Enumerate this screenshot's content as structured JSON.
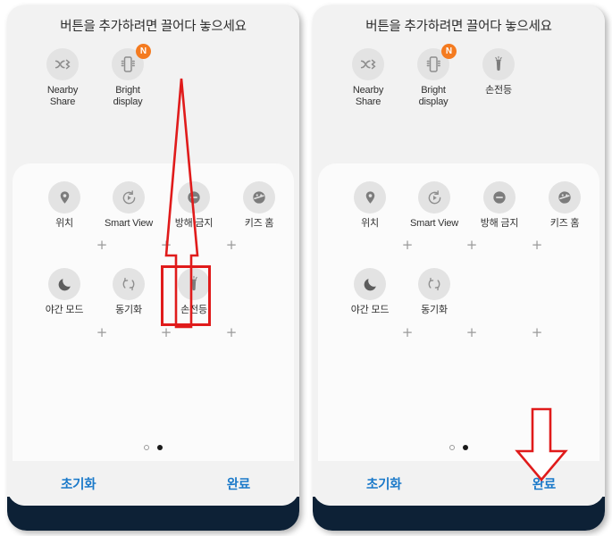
{
  "screen_title": "버튼을 추가하려면 끌어다 놓으세요",
  "colors": {
    "annotation_red": "#e01b1b",
    "action_blue": "#1a79c9",
    "badge_orange": "#f47b20",
    "icon_bg": "#e3e3e3",
    "top_zone_bg": "#f2f2f2",
    "panel_bg": "#fbfbfb",
    "bezel": "#0d2136"
  },
  "panels": [
    {
      "id": "before",
      "available_tiles": [
        {
          "label": "Nearby\nShare",
          "icon": "nearby-share-icon",
          "badge": null
        },
        {
          "label": "Bright\ndisplay",
          "icon": "bright-display-icon",
          "badge": "N"
        }
      ],
      "quick_panel_rows": [
        [
          {
            "label": "위치",
            "icon": "location-pin-icon"
          },
          {
            "label": "Smart View",
            "icon": "smart-view-icon"
          },
          {
            "label": "방해 금지",
            "icon": "do-not-disturb-icon"
          },
          {
            "label": "키즈 홈",
            "icon": "kids-home-icon"
          }
        ],
        [
          {
            "label": "야간 모드",
            "icon": "night-mode-icon"
          },
          {
            "label": "동기화",
            "icon": "sync-icon"
          },
          {
            "label": "손전등",
            "icon": "flashlight-icon"
          }
        ]
      ],
      "placeholder_rows": 2,
      "placeholders_per_row": 3,
      "page_dots": [
        "hollow",
        "solid"
      ],
      "actions": {
        "reset": "초기화",
        "done": "완료"
      },
      "annotations": {
        "highlight_target": "손전등",
        "arrow": "up-arrow",
        "box": true
      }
    },
    {
      "id": "after",
      "available_tiles": [
        {
          "label": "Nearby\nShare",
          "icon": "nearby-share-icon",
          "badge": null
        },
        {
          "label": "Bright\ndisplay",
          "icon": "bright-display-icon",
          "badge": "N"
        },
        {
          "label": "손전등",
          "icon": "flashlight-icon",
          "badge": null
        }
      ],
      "quick_panel_rows": [
        [
          {
            "label": "위치",
            "icon": "location-pin-icon"
          },
          {
            "label": "Smart View",
            "icon": "smart-view-icon"
          },
          {
            "label": "방해 금지",
            "icon": "do-not-disturb-icon"
          },
          {
            "label": "키즈 홈",
            "icon": "kids-home-icon"
          }
        ],
        [
          {
            "label": "야간 모드",
            "icon": "night-mode-icon"
          },
          {
            "label": "동기화",
            "icon": "sync-icon"
          }
        ]
      ],
      "placeholder_rows": 2,
      "placeholders_per_row": 3,
      "page_dots": [
        "hollow",
        "solid"
      ],
      "actions": {
        "reset": "초기화",
        "done": "완료"
      },
      "annotations": {
        "highlight_target": "완료",
        "arrow": "down-arrow",
        "box": false
      }
    }
  ]
}
